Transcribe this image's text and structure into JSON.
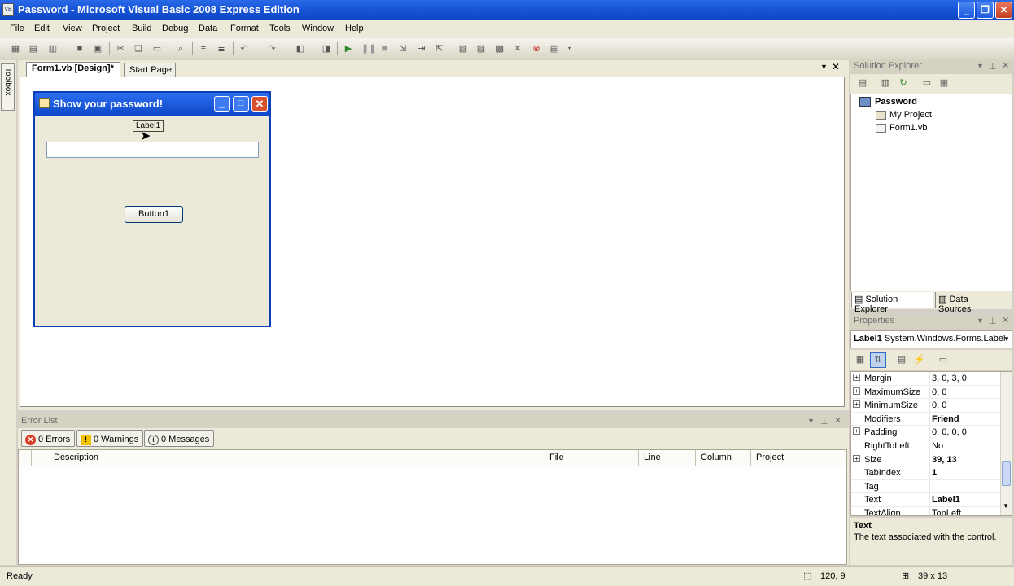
{
  "window": {
    "title": "Password - Microsoft Visual Basic 2008 Express Edition",
    "icon_text": "VB"
  },
  "menu": [
    "File",
    "Edit",
    "View",
    "Project",
    "Build",
    "Debug",
    "Data",
    "Format",
    "Tools",
    "Window",
    "Help"
  ],
  "tabs": {
    "active": "Form1.vb [Design]*",
    "inactive": "Start Page",
    "toolbox": "Toolbox"
  },
  "form": {
    "title": "Show your password!",
    "label": "Label1",
    "button": "Button1"
  },
  "solution_explorer": {
    "header": "Solution Explorer",
    "root": "Password",
    "items": [
      "My Project",
      "Form1.vb"
    ],
    "tab1": "Solution Explorer",
    "tab2": "Data Sources"
  },
  "properties": {
    "header": "Properties",
    "object_name": "Label1",
    "object_type": "System.Windows.Forms.Label",
    "rows": [
      {
        "name": "Margin",
        "value": "3, 0, 3, 0",
        "expandable": true,
        "bold": false
      },
      {
        "name": "MaximumSize",
        "value": "0, 0",
        "expandable": true,
        "bold": false
      },
      {
        "name": "MinimumSize",
        "value": "0, 0",
        "expandable": true,
        "bold": false
      },
      {
        "name": "Modifiers",
        "value": "Friend",
        "expandable": false,
        "bold": true
      },
      {
        "name": "Padding",
        "value": "0, 0, 0, 0",
        "expandable": true,
        "bold": false
      },
      {
        "name": "RightToLeft",
        "value": "No",
        "expandable": false,
        "bold": false
      },
      {
        "name": "Size",
        "value": "39, 13",
        "expandable": true,
        "bold": true
      },
      {
        "name": "TabIndex",
        "value": "1",
        "expandable": false,
        "bold": true
      },
      {
        "name": "Tag",
        "value": "",
        "expandable": false,
        "bold": false
      },
      {
        "name": "Text",
        "value": "Label1",
        "expandable": false,
        "bold": true
      },
      {
        "name": "TextAlign",
        "value": "TopLeft",
        "expandable": false,
        "bold": false
      }
    ],
    "desc_title": "Text",
    "desc_text": "The text associated with the control."
  },
  "error_list": {
    "header": "Error List",
    "errors": "0 Errors",
    "warnings": "0 Warnings",
    "messages": "0 Messages",
    "columns": [
      "Description",
      "File",
      "Line",
      "Column",
      "Project"
    ]
  },
  "status": {
    "text": "Ready",
    "position": "120, 9",
    "size": "39 x 13"
  },
  "colors": {
    "titlebar": "#0d46c4",
    "form_titlebar": "#2d6ef0",
    "error_icon": "#d9402a",
    "warning_icon": "#f2c200"
  }
}
